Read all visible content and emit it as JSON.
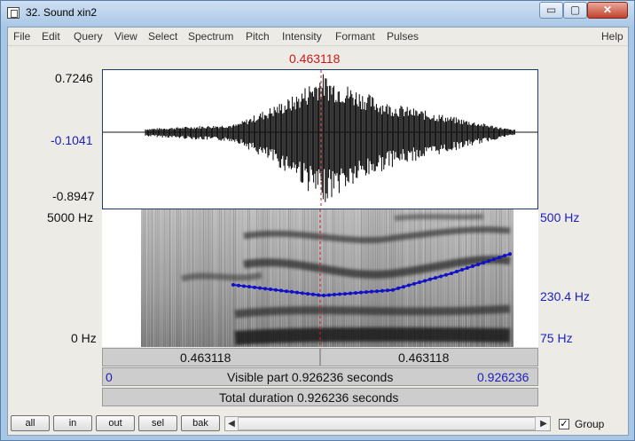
{
  "window": {
    "title": "32. Sound xin2",
    "min_glyph": "▭",
    "max_glyph": "▢",
    "close_glyph": "✕"
  },
  "menu": [
    "File",
    "Edit",
    "Query",
    "View",
    "Select",
    "Spectrum",
    "Pitch",
    "Intensity",
    "Formant",
    "Pulses"
  ],
  "help": "Help",
  "cursor_time": "0.463118",
  "wave": {
    "ymax": "0.7246",
    "ymid": "-0.1041",
    "ymin": "-0.8947"
  },
  "spectrum": {
    "fmax": "5000 Hz",
    "fmin": "0 Hz"
  },
  "pitch": {
    "max": "500 Hz",
    "mid": "230.4 Hz",
    "min": "75 Hz"
  },
  "time_row": {
    "left": "0.463118",
    "right": "0.463118"
  },
  "visible": {
    "start": "0",
    "text": "Visible part 0.926236 seconds",
    "end": "0.926236"
  },
  "total": {
    "text": "Total duration 0.926236 seconds"
  },
  "buttons": {
    "all": "all",
    "in": "in",
    "out": "out",
    "sel": "sel",
    "bak": "bak"
  },
  "scroll": {
    "left_arrow": "◀",
    "right_arrow": "▶"
  },
  "group": {
    "label": "Group",
    "checked": "✓"
  },
  "colors": {
    "pitch_line": "#1010c8",
    "cursor": "#d01818",
    "label_blue": "#1d1dbd"
  }
}
